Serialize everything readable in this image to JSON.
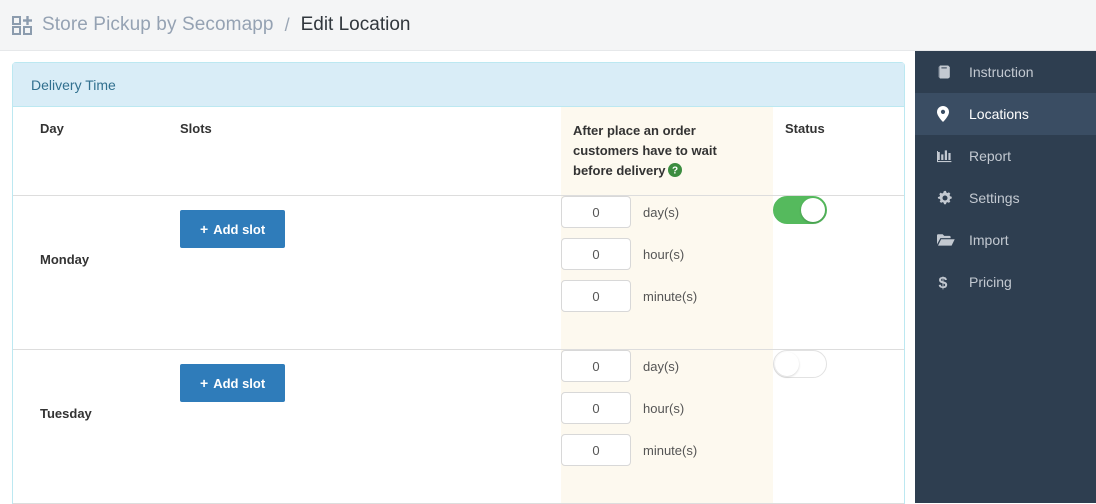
{
  "breadcrumb": {
    "app_icon": "grid-plus-icon",
    "app_name": "Store Pickup by Secomapp",
    "separator": "/",
    "current": "Edit Location"
  },
  "sidebar": {
    "items": [
      {
        "label": "Instruction",
        "icon": "book-icon",
        "active": false
      },
      {
        "label": "Locations",
        "icon": "map-marker-icon",
        "active": true
      },
      {
        "label": "Report",
        "icon": "bar-chart-icon",
        "active": false
      },
      {
        "label": "Settings",
        "icon": "gear-icon",
        "active": false
      },
      {
        "label": "Import",
        "icon": "folder-open-icon",
        "active": false
      },
      {
        "label": "Pricing",
        "icon": "dollar-icon",
        "active": false
      }
    ]
  },
  "panel": {
    "title": "Delivery Time",
    "columns": {
      "day": "Day",
      "slots": "Slots",
      "wait": "After place an order customers have to wait before delivery",
      "wait_help_icon": "question-circle-icon",
      "status": "Status"
    },
    "add_slot_label": "Add slot",
    "add_slot_plus": "+",
    "rows": [
      {
        "day": "Monday",
        "wait": [
          {
            "value": "0",
            "unit": "day(s)",
            "placeholder": "0"
          },
          {
            "value": "0",
            "unit": "hour(s)",
            "placeholder": "0"
          },
          {
            "value": "0",
            "unit": "minute(s)",
            "placeholder": "0"
          }
        ],
        "status_on": true
      },
      {
        "day": "Tuesday",
        "wait": [
          {
            "value": "0",
            "unit": "day(s)",
            "placeholder": "0"
          },
          {
            "value": "0",
            "unit": "hour(s)",
            "placeholder": "0"
          },
          {
            "value": "0",
            "unit": "minute(s)",
            "placeholder": "0"
          }
        ],
        "status_on": false
      }
    ]
  },
  "colors": {
    "sidebar_bg": "#2e3e50",
    "sidebar_active_bg": "#3a4d63",
    "panel_head_bg": "#d9edf7",
    "panel_border": "#bce8f1",
    "panel_title": "#31708f",
    "wait_column_bg": "#fdf9ef",
    "primary_button": "#2f7cba",
    "toggle_on": "#55ba5d",
    "help_icon": "#3c8d40",
    "topbar_bg": "#f4f5f6"
  }
}
